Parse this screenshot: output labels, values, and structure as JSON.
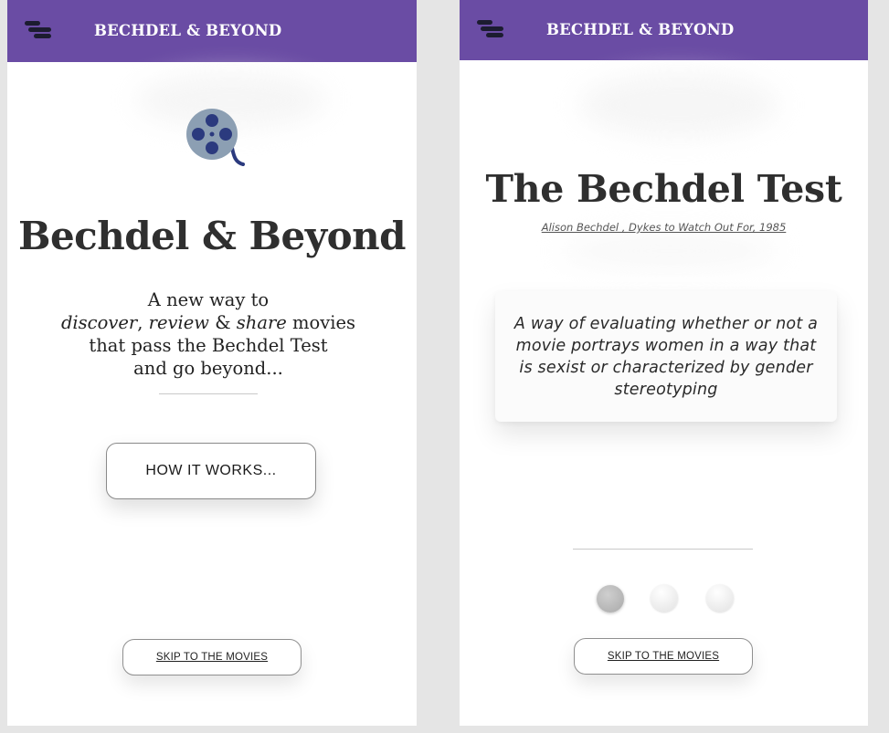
{
  "screens": [
    {
      "appbar": {
        "title": "BECHDEL & BEYOND",
        "menu_icon": "hamburger-menu-icon"
      },
      "logo_icon": "film-reel-icon",
      "hero_title": "Bechdel & Beyond",
      "tagline": {
        "line1": "A new way to",
        "discover": "discover",
        "comma": ",",
        "review": "review",
        "amp": "&",
        "share": "share",
        "movies": "movies",
        "line3": "that pass the Bechdel Test",
        "line4": "and go beyond..."
      },
      "how_button": "HOW IT WORKS...",
      "skip_button": "SKIP TO THE MOVIES"
    },
    {
      "appbar": {
        "title": "BECHDEL & BEYOND",
        "menu_icon": "hamburger-menu-icon"
      },
      "title": "The Bechdel Test",
      "citation": "Alison Bechdel , Dykes to Watch Out For, 1985",
      "definition": "A way of evaluating whether or not a movie portrays women in a way that is sexist or characterized by gender stereotyping",
      "pager": {
        "count": 3,
        "active_index": 0
      },
      "skip_button": "SKIP TO THE MOVIES"
    }
  ],
  "colors": {
    "appbar": "#6a4ca4",
    "menu_icon": "#1c1c30",
    "reel_body": "#8c9fb3",
    "reel_holes": "#2b3a7e",
    "background": "#e5e5e5"
  }
}
